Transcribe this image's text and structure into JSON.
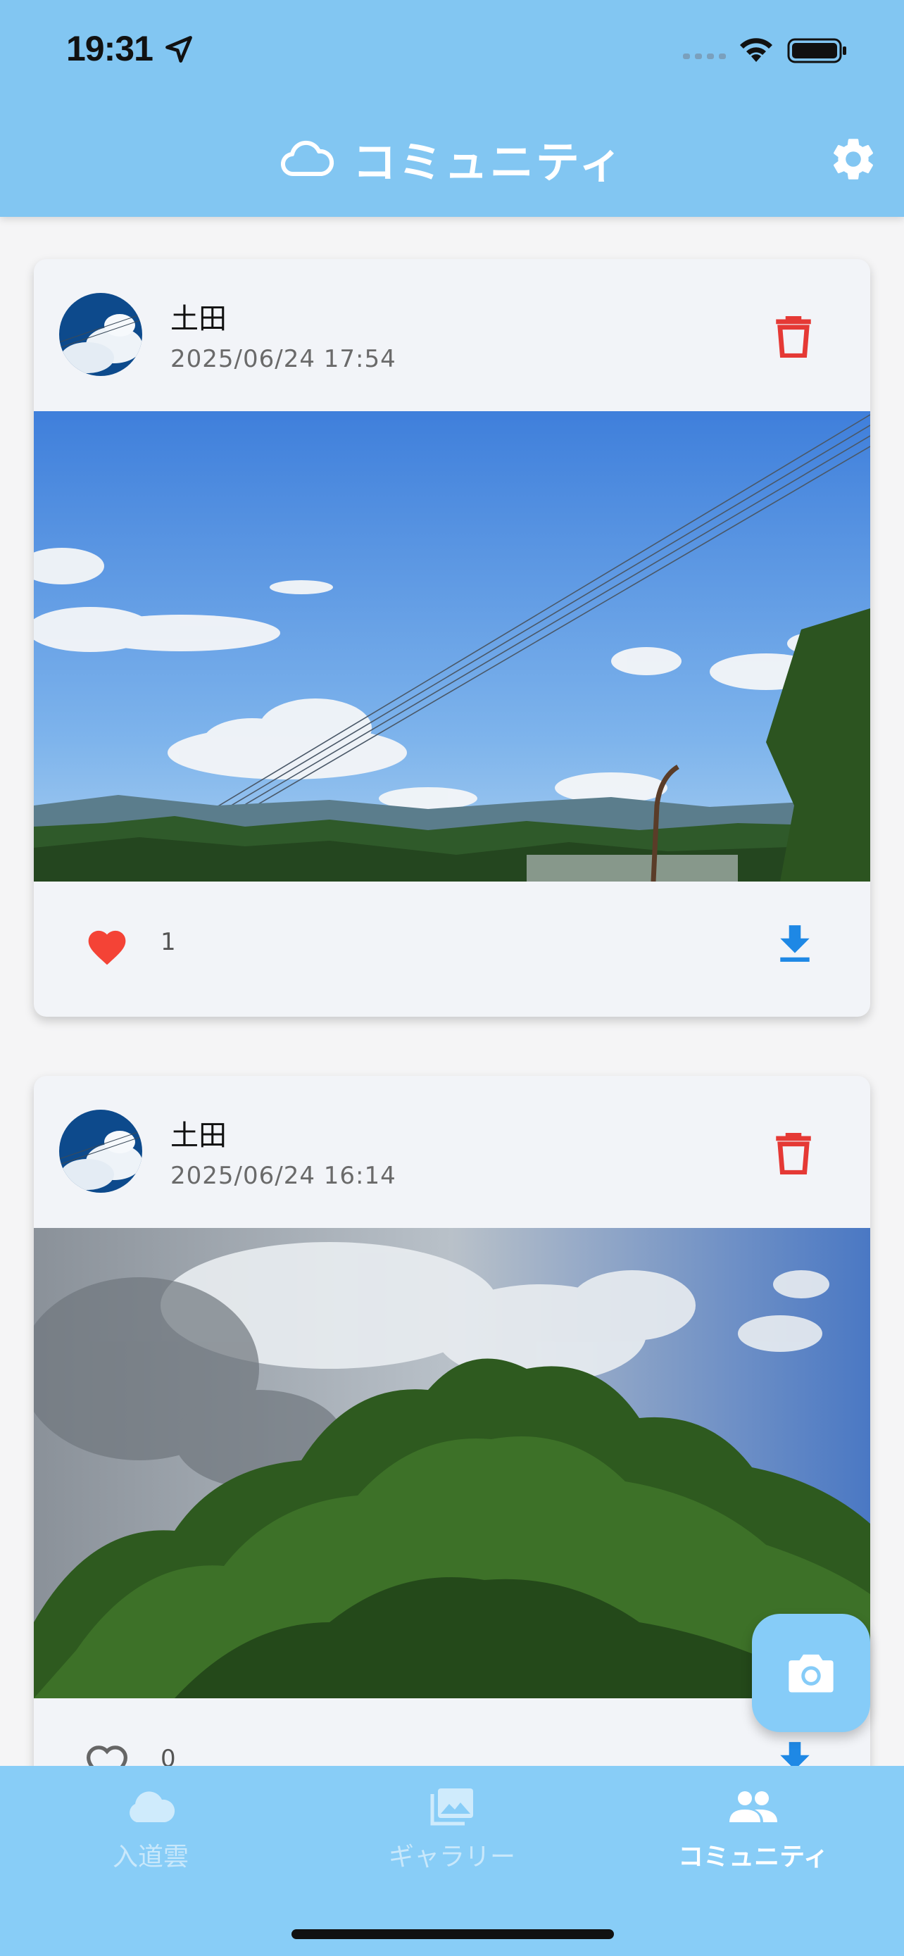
{
  "status_bar": {
    "time": "19:31"
  },
  "header": {
    "title": "コミュニティ"
  },
  "posts": [
    {
      "user": "土田",
      "date": "2025/06/24 17:54",
      "likes": "1",
      "liked": true
    },
    {
      "user": "土田",
      "date": "2025/06/24 16:14",
      "likes": "0",
      "liked": false
    }
  ],
  "bottom_nav": {
    "items": [
      {
        "label": "入道雲",
        "icon": "cloud-icon",
        "active": false
      },
      {
        "label": "ギャラリー",
        "icon": "photo-library-icon",
        "active": false
      },
      {
        "label": "コミュニティ",
        "icon": "people-icon",
        "active": true
      }
    ]
  },
  "colors": {
    "header_bg": "#82c6f2",
    "nav_bg": "#88cdf7",
    "delete": "#e53935",
    "like": "#f44336",
    "download": "#1e88e5"
  }
}
